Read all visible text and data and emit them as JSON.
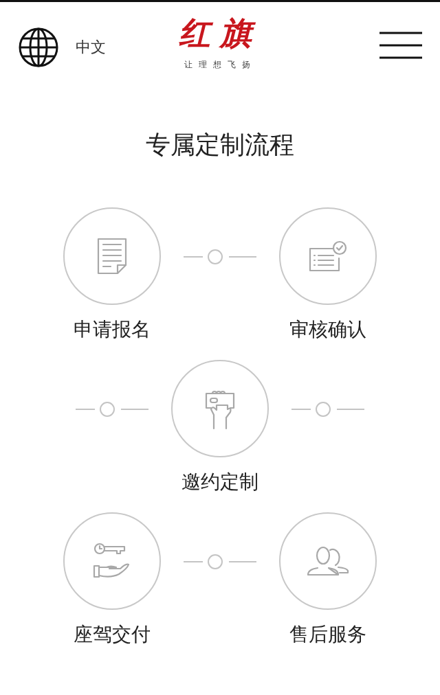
{
  "header": {
    "language": "中文",
    "logo": "红旗",
    "slogan": "让理想飞扬"
  },
  "title": "专属定制流程",
  "rows": [
    [
      {
        "kind": "step",
        "label": "申请报名"
      },
      {
        "kind": "connector"
      },
      {
        "kind": "step",
        "label": "审核确认"
      }
    ],
    [
      {
        "kind": "connector"
      },
      {
        "kind": "step",
        "label": "邀约定制"
      },
      {
        "kind": "connector"
      }
    ],
    [
      {
        "kind": "step",
        "label": "座驾交付"
      },
      {
        "kind": "connector"
      },
      {
        "kind": "step",
        "label": "售后服务"
      }
    ]
  ]
}
